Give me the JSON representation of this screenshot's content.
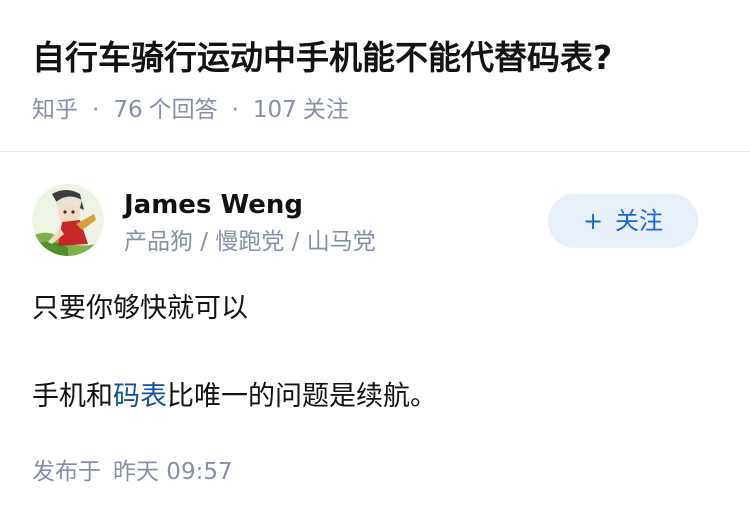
{
  "question": {
    "title": "自行车骑行运动中手机能不能代替码表?",
    "source": "知乎",
    "separator": "·",
    "answer_count": "76",
    "answer_label": "个回答",
    "follower_count": "107",
    "follower_label": "关注"
  },
  "author": {
    "name": "James Weng",
    "bio": "产品狗 / 慢跑党 / 山马党",
    "avatar_icon": "anime-avatar-icon"
  },
  "follow_button": {
    "plus": "+",
    "label": "关注"
  },
  "answer": {
    "line1": "只要你够快就可以",
    "line2_before": "手机和",
    "line2_link": "码表",
    "line2_after": "比唯一的问题是续航。"
  },
  "meta": {
    "published_label": "发布于",
    "published_time": "昨天 09:57"
  },
  "colors": {
    "title": "#121212",
    "meta": "#8590a6",
    "link": "#175199",
    "follow_bg": "#e8f0fa",
    "follow_text": "#1a66cc",
    "divider": "#ebebeb"
  }
}
